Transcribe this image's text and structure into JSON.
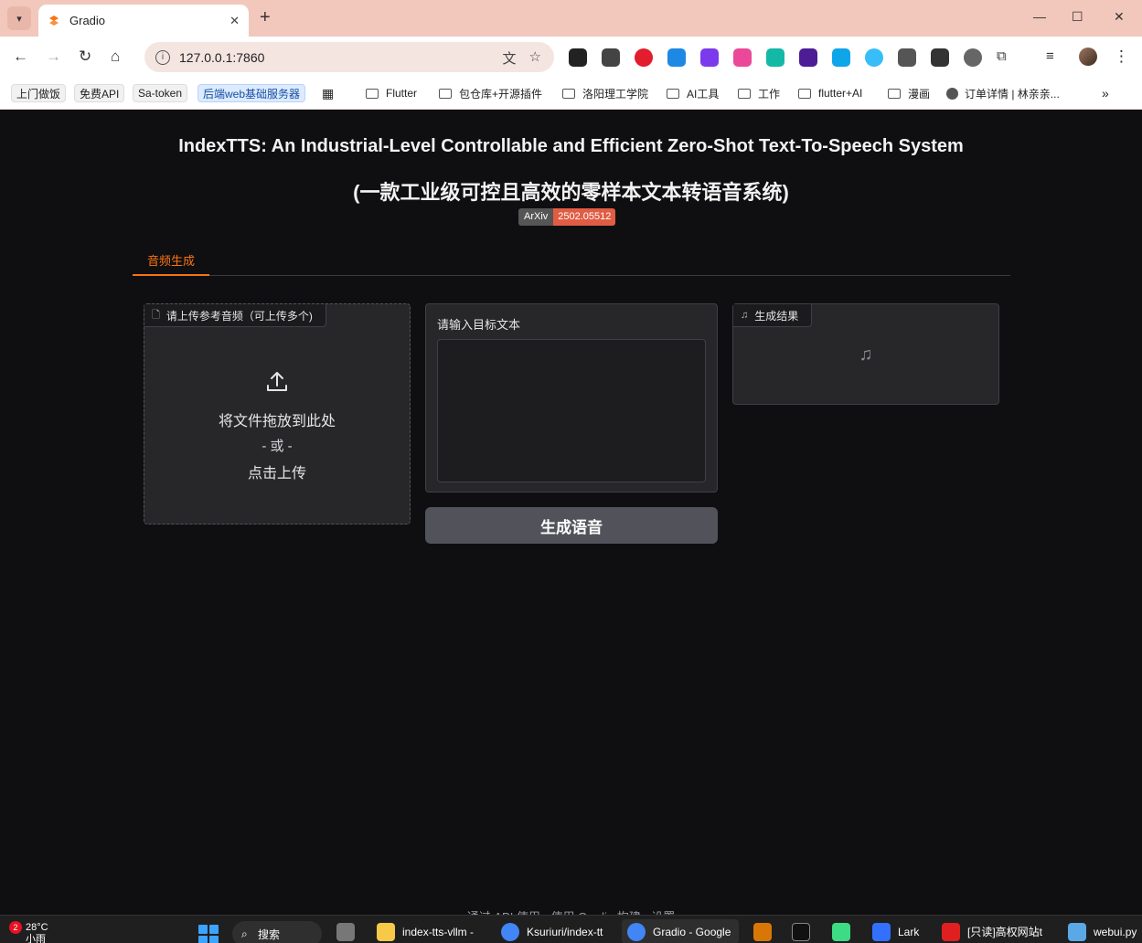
{
  "browser": {
    "tab_title": "Gradio",
    "url": "127.0.0.1:7860",
    "bookmarks": [
      "上门做饭",
      "免费API",
      "Sa-token",
      "后端web基础服务器",
      "Flutter",
      "包仓库+开源插件",
      "洛阳理工学院",
      "AI工具",
      "工作",
      "flutter+AI",
      "漫画",
      "订单详情 | 林亲亲..."
    ]
  },
  "page": {
    "title_en": "IndexTTS: An Industrial-Level Controllable and Efficient Zero-Shot Text-To-Speech System",
    "title_zh": "(一款工业级可控且高效的零样本文本转语音系统)",
    "badge_left": "ArXiv",
    "badge_right": "2502.05512",
    "tab_label": "音频生成"
  },
  "upload": {
    "label": "请上传参考音频（可上传多个)",
    "drop_text": "将文件拖放到此处",
    "or_text": "- 或 -",
    "click_text": "点击上传"
  },
  "text_input": {
    "label": "请输入目标文本",
    "value": ""
  },
  "generate_button": "生成语音",
  "result": {
    "label": "生成结果"
  },
  "footer": "通过 API 使用 · 使用 Gradio 构建 · 设置",
  "taskbar": {
    "notification_count": "2",
    "temperature": "28°C",
    "weather": "小雨",
    "search": "搜索",
    "items": [
      "index-tts-vllm -",
      "Ksuriuri/index-tt",
      "Gradio - Google",
      "Lark",
      "[只读]高权网站t",
      "webui.py"
    ]
  },
  "colors": {
    "accent": "#f97316",
    "page_bg": "#0f0f11",
    "panel_bg": "#27272a",
    "button_bg": "#52525b",
    "badge_red": "#e05d44"
  }
}
